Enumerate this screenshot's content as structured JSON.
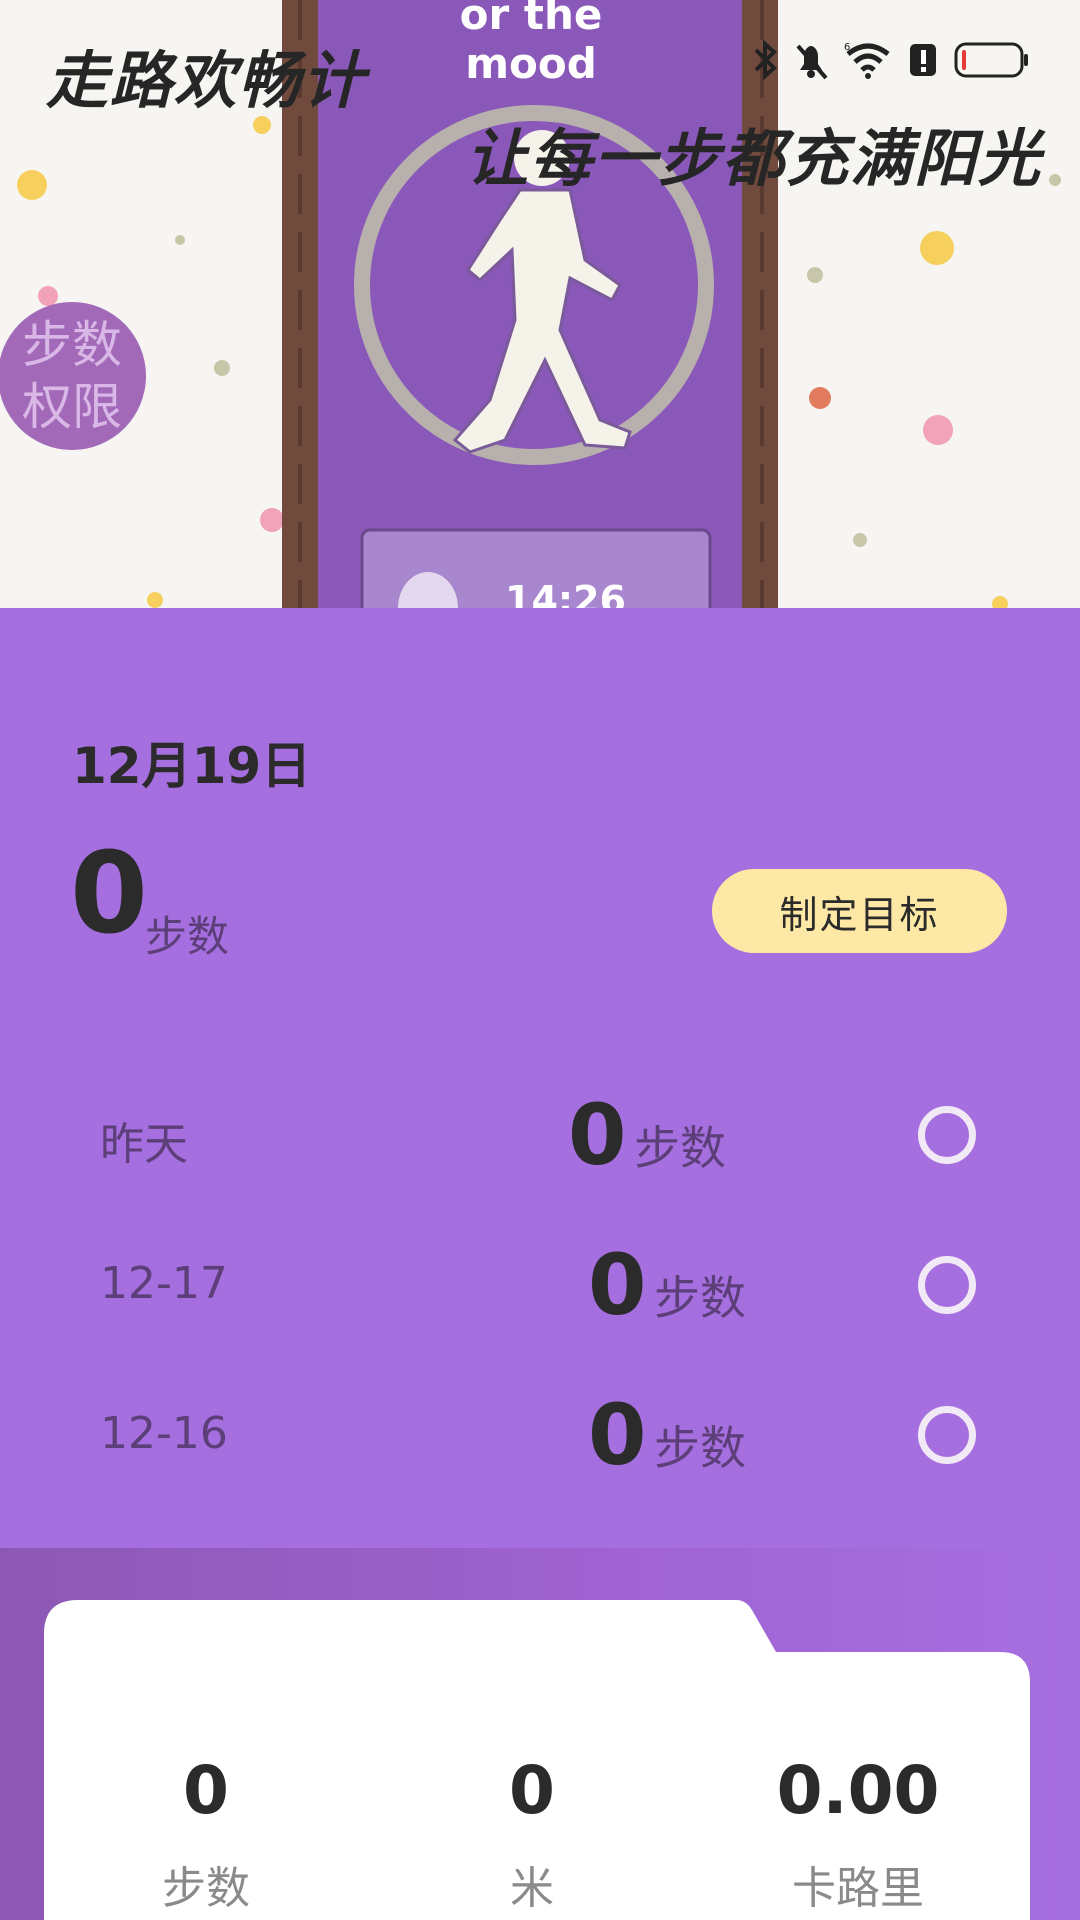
{
  "hero": {
    "title": "走路欢畅计",
    "subtitle": "让每一步都充满阳光",
    "phone_caption": "or the mood",
    "screen_time": "14:26",
    "permission_badge": [
      "步数",
      "权限"
    ]
  },
  "status_bar": {
    "icons": [
      "bluetooth-icon",
      "mute-icon",
      "wifi-icon",
      "alert-icon",
      "battery-icon"
    ],
    "battery_level": 0.08,
    "battery_color": "#e53935"
  },
  "today": {
    "date": "12月19日",
    "steps": "0",
    "unit": "步数",
    "goal_button": "制定目标"
  },
  "history": [
    {
      "label": "昨天",
      "steps": "0",
      "unit": "步数"
    },
    {
      "label": "12-17",
      "steps": "0",
      "unit": "步数"
    },
    {
      "label": "12-16",
      "steps": "0",
      "unit": "步数"
    }
  ],
  "stats": [
    {
      "value": "0",
      "label": "步数"
    },
    {
      "value": "0",
      "label": "米"
    },
    {
      "value": "0.00",
      "label": "卡路里"
    }
  ],
  "colors": {
    "accent": "#a66fe0",
    "goal_button": "#fde9a5",
    "text_dark": "#2b2b2b"
  }
}
